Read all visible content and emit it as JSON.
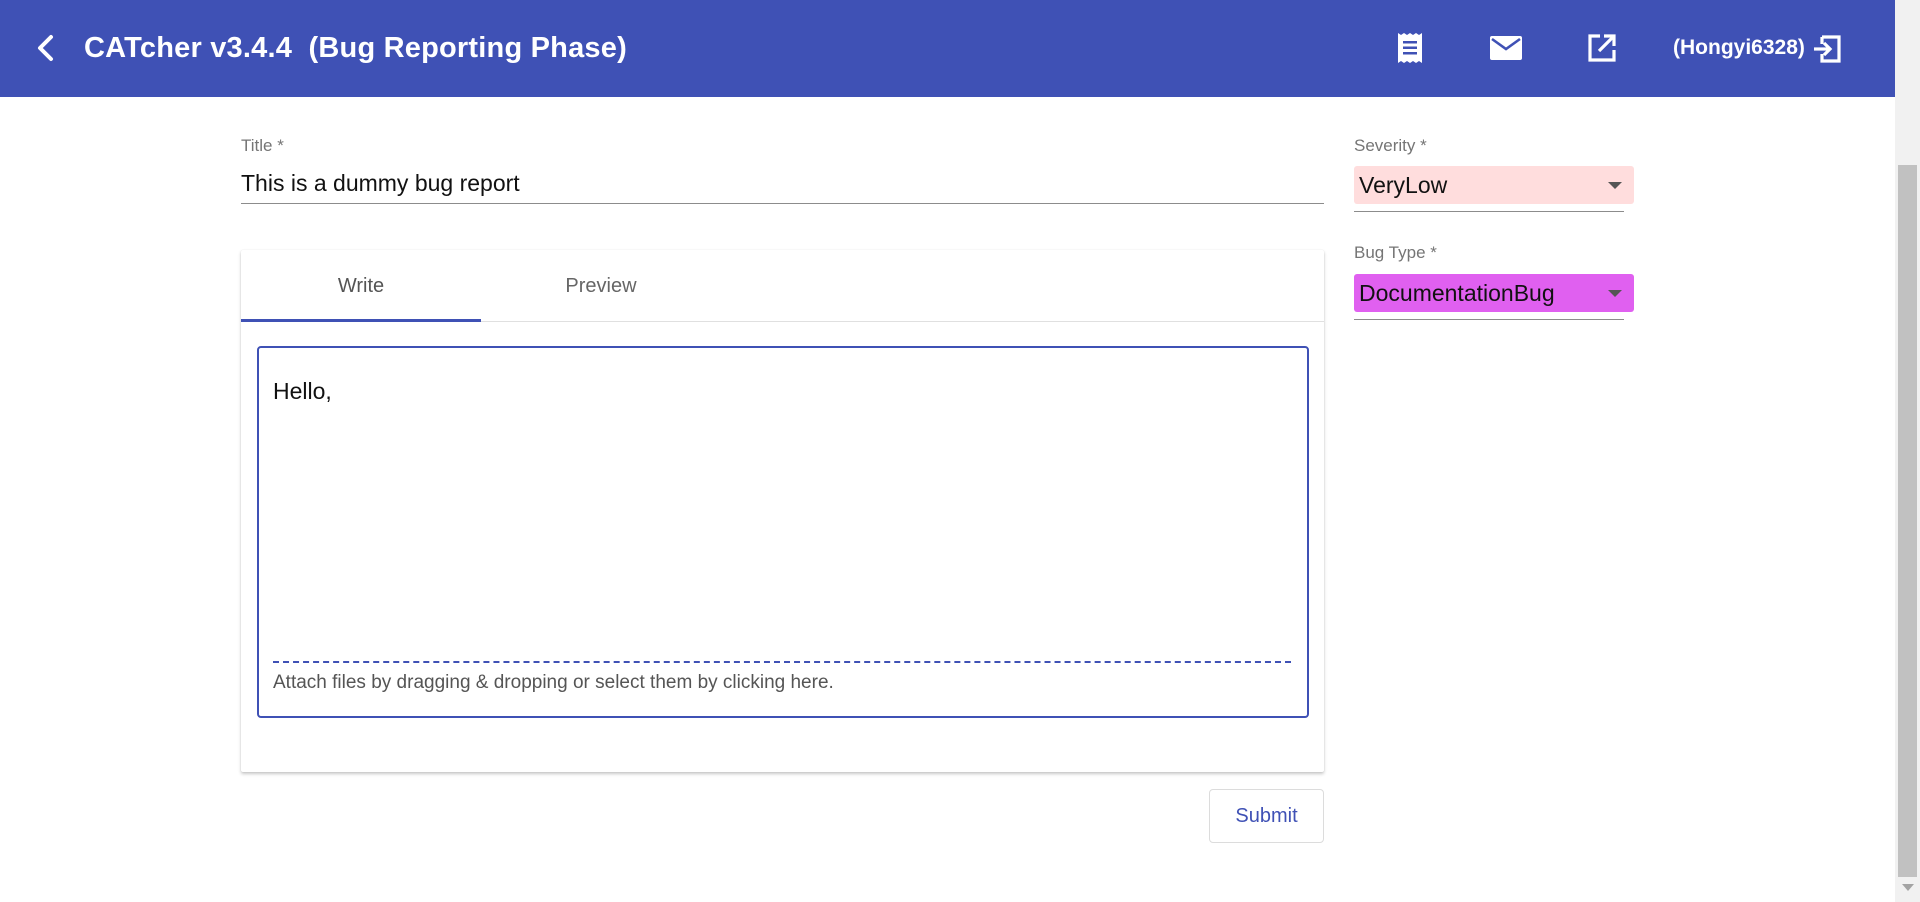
{
  "header": {
    "title": "CATcher v3.4.4  (Bug Reporting Phase)",
    "username": "(Hongyi6328)",
    "background_color": "#3f51b5",
    "icons": [
      "back-arrow-icon",
      "document-icon",
      "mail-icon",
      "open-in-new-icon",
      "logout-icon"
    ]
  },
  "form": {
    "title_label": "Title *",
    "title_value": "This is a dummy bug report",
    "tabs": [
      {
        "label": "Write",
        "active": true
      },
      {
        "label": "Preview",
        "active": false
      }
    ],
    "description_value": "Hello,",
    "attach_hint": "Attach files by dragging & dropping or select them by clicking here.",
    "submit_label": "Submit"
  },
  "sidebar": {
    "severity": {
      "label": "Severity *",
      "value": "VeryLow",
      "color": "#ffdddd"
    },
    "bug_type": {
      "label": "Bug Type *",
      "value": "DocumentationBug",
      "color": "#e060f0"
    }
  },
  "colors": {
    "accent": "#3f51b5"
  }
}
